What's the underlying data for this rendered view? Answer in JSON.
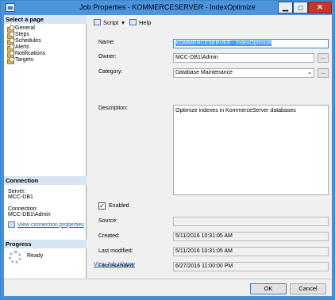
{
  "window": {
    "title": "Job Properties - KOMMERCESERVER - IndexOptimize"
  },
  "select_page": {
    "header": "Select a page",
    "items": [
      "General",
      "Steps",
      "Schedules",
      "Alerts",
      "Notifications",
      "Targets"
    ]
  },
  "connection": {
    "header": "Connection",
    "server_label": "Server:",
    "server_value": "MCC-DB1",
    "connection_label": "Connection:",
    "connection_value": "MCC-DB1\\Admin",
    "view_link": "View connection properties"
  },
  "progress": {
    "header": "Progress",
    "status": "Ready"
  },
  "toolbar": {
    "script": "Script",
    "help": "Help"
  },
  "form": {
    "name_label": "Name:",
    "name_value": "KOMMERCESERVER - IndexOptimize",
    "owner_label": "Owner:",
    "owner_value": "MCC-DB1\\Admin",
    "category_label": "Category:",
    "category_value": "Database Maintenance",
    "description_label": "Description:",
    "description_value": "Optimize indexes in KommerceServer databases",
    "enabled_label": "Enabled",
    "source_label": "Source:",
    "source_value": "",
    "created_label": "Created:",
    "created_value": "5/11/2016 10:31:05 AM",
    "modified_label": "Last modified:",
    "modified_value": "5/11/2016 10:31:05 AM",
    "executed_label": "Last executed:",
    "executed_value": "6/27/2016 11:00:00 PM",
    "history_link": "View Job History",
    "browse": "..."
  },
  "buttons": {
    "ok": "OK",
    "cancel": "Cancel"
  }
}
